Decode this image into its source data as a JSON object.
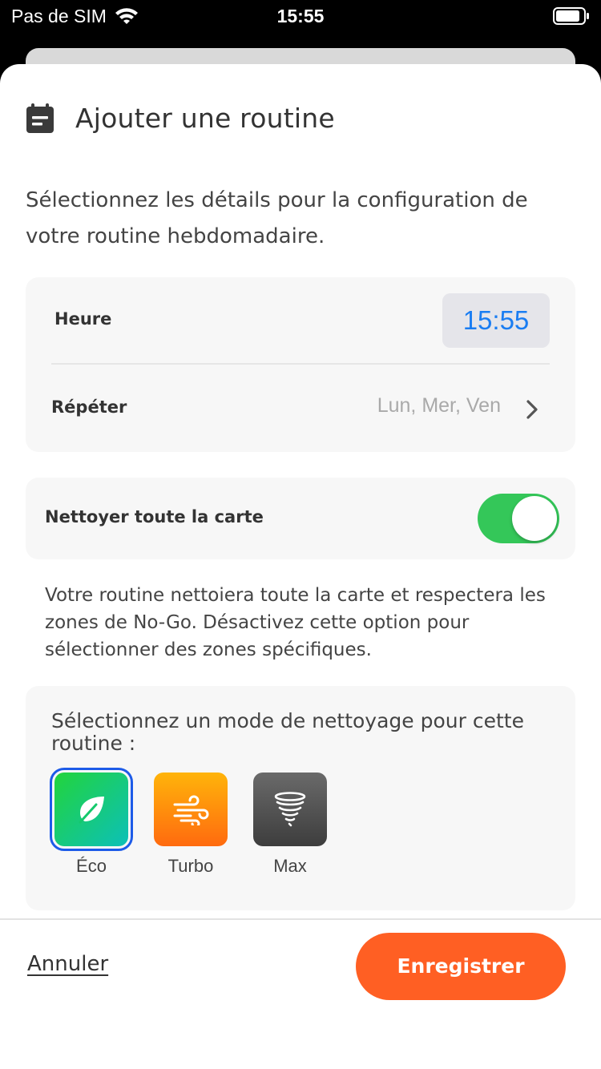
{
  "status_bar": {
    "carrier": "Pas de SIM",
    "time": "15:55",
    "icons": [
      "wifi-icon",
      "battery-icon"
    ]
  },
  "header": {
    "icon": "calendar-icon",
    "title": "Ajouter une routine"
  },
  "intro": "Sélectionnez les détails pour la configuration de votre routine hebdomadaire.",
  "schedule": {
    "time_label": "Heure",
    "time_value": "15:55",
    "repeat_label": "Répéter",
    "repeat_value": "Lun, Mer, Ven"
  },
  "clean_all": {
    "label": "Nettoyer toute la carte",
    "enabled": true,
    "note": "Votre routine nettoiera toute la carte et respectera les zones de No-Go. Désactivez cette option pour sélectionner des zones spécifiques."
  },
  "mode": {
    "title": "Sélectionnez un mode de nettoyage pour cette routine :",
    "options": [
      {
        "label": "Éco",
        "icon": "leaf-icon",
        "selected": true
      },
      {
        "label": "Turbo",
        "icon": "wind-icon",
        "selected": false
      },
      {
        "label": "Max",
        "icon": "tornado-icon",
        "selected": false
      }
    ]
  },
  "footer": {
    "cancel_label": "Annuler",
    "save_label": "Enregistrer"
  },
  "colors": {
    "accent": "#ff5f23",
    "toggle_on": "#34c759",
    "time_text": "#1a7df2",
    "selection_outline": "#1d5be8"
  }
}
